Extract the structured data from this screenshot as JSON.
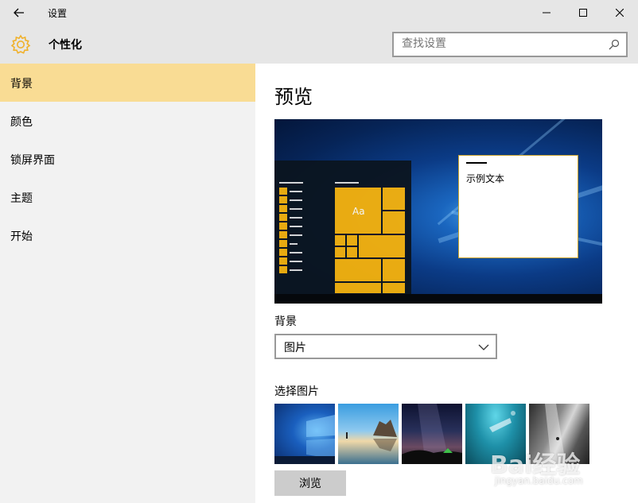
{
  "window": {
    "title": "设置",
    "back_icon": "arrow-left-icon",
    "minimize_icon": "minimize-icon",
    "maximize_icon": "maximize-icon",
    "close_icon": "close-icon"
  },
  "header": {
    "icon": "gear-icon",
    "title": "个性化",
    "search_placeholder": "查找设置",
    "search_icon": "search-icon"
  },
  "sidebar": {
    "items": [
      {
        "label": "背景",
        "selected": true
      },
      {
        "label": "颜色",
        "selected": false
      },
      {
        "label": "锁屏界面",
        "selected": false
      },
      {
        "label": "主题",
        "selected": false
      },
      {
        "label": "开始",
        "selected": false
      }
    ]
  },
  "main": {
    "preview_title": "预览",
    "preview": {
      "tile_label": "Aa",
      "sample_text": "示例文本"
    },
    "background_label": "背景",
    "background_value": "图片",
    "choose_picture_label": "选择图片",
    "browse_label": "浏览"
  },
  "watermark": {
    "brand": "Bai经验",
    "url": "jingyan.baidu.com"
  },
  "colors": {
    "accent": "#f5b20d",
    "selected_nav": "#f9dc94",
    "chrome": "#e6e6e6",
    "sidebar": "#f2f2f2"
  }
}
